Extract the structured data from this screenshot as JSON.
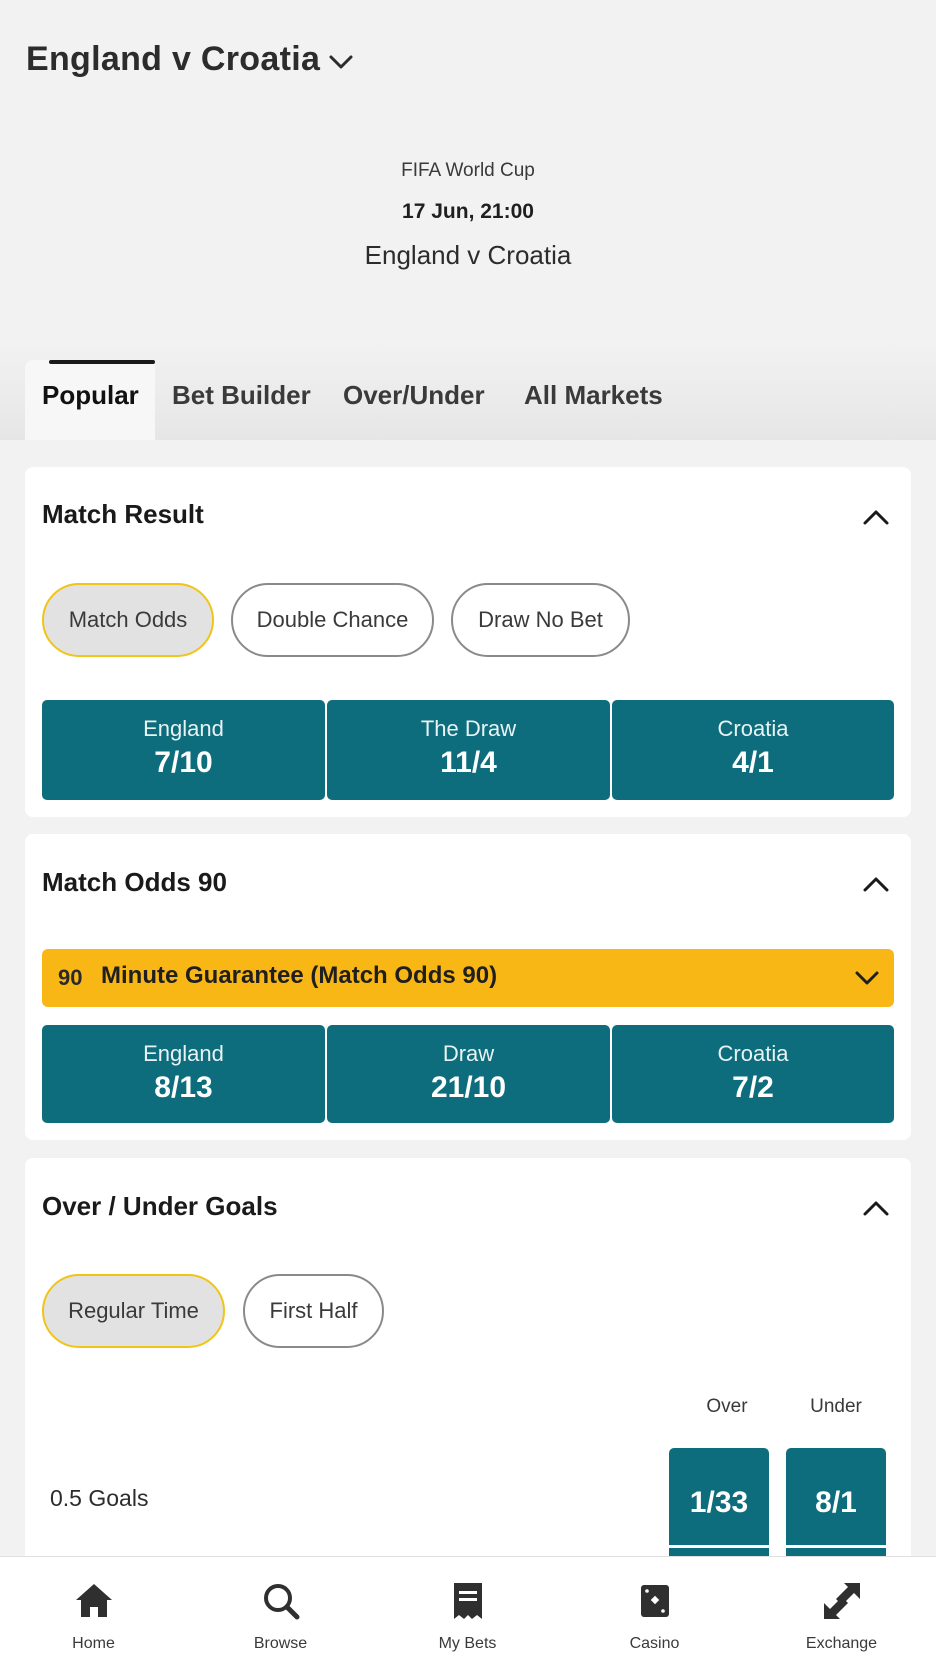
{
  "header": {
    "title": "England v Croatia"
  },
  "event": {
    "competition": "FIFA World Cup",
    "kickoff": "17 Jun, 21:00",
    "fixture": "England v Croatia"
  },
  "tabs": [
    {
      "label": "Popular",
      "active": true
    },
    {
      "label": "Bet Builder"
    },
    {
      "label": "Over/Under"
    },
    {
      "label": "All Markets"
    }
  ],
  "match_result": {
    "title": "Match Result",
    "filters": [
      {
        "label": "Match Odds",
        "selected": true
      },
      {
        "label": "Double Chance"
      },
      {
        "label": "Draw No Bet"
      }
    ],
    "selections": [
      {
        "name": "England",
        "odds": "7/10"
      },
      {
        "name": "The Draw",
        "odds": "11/4"
      },
      {
        "name": "Croatia",
        "odds": "4/1"
      }
    ]
  },
  "match_odds_90": {
    "title": "Match Odds 90",
    "guarantee_badge": "90",
    "guarantee_text": "Minute Guarantee (Match Odds 90)",
    "selections": [
      {
        "name": "England",
        "odds": "8/13"
      },
      {
        "name": "Draw",
        "odds": "21/10"
      },
      {
        "name": "Croatia",
        "odds": "7/2"
      }
    ]
  },
  "over_under": {
    "title": "Over / Under Goals",
    "filters": [
      {
        "label": "Regular Time",
        "selected": true
      },
      {
        "label": "First Half"
      }
    ],
    "columns": [
      "Over",
      "Under"
    ],
    "rows": [
      {
        "label": "0.5 Goals",
        "over": "1/33",
        "under": "8/1"
      }
    ]
  },
  "bottom_nav": [
    {
      "label": "Home",
      "icon": "home-icon"
    },
    {
      "label": "Browse",
      "icon": "search-icon"
    },
    {
      "label": "My Bets",
      "icon": "bet-slip-icon"
    },
    {
      "label": "Casino",
      "icon": "casino-icon"
    },
    {
      "label": "Exchange",
      "icon": "exchange-icon"
    }
  ],
  "colors": {
    "accent": "#0e6d7c",
    "highlight": "#f9b716",
    "pill_border_selected": "#f0c419"
  }
}
